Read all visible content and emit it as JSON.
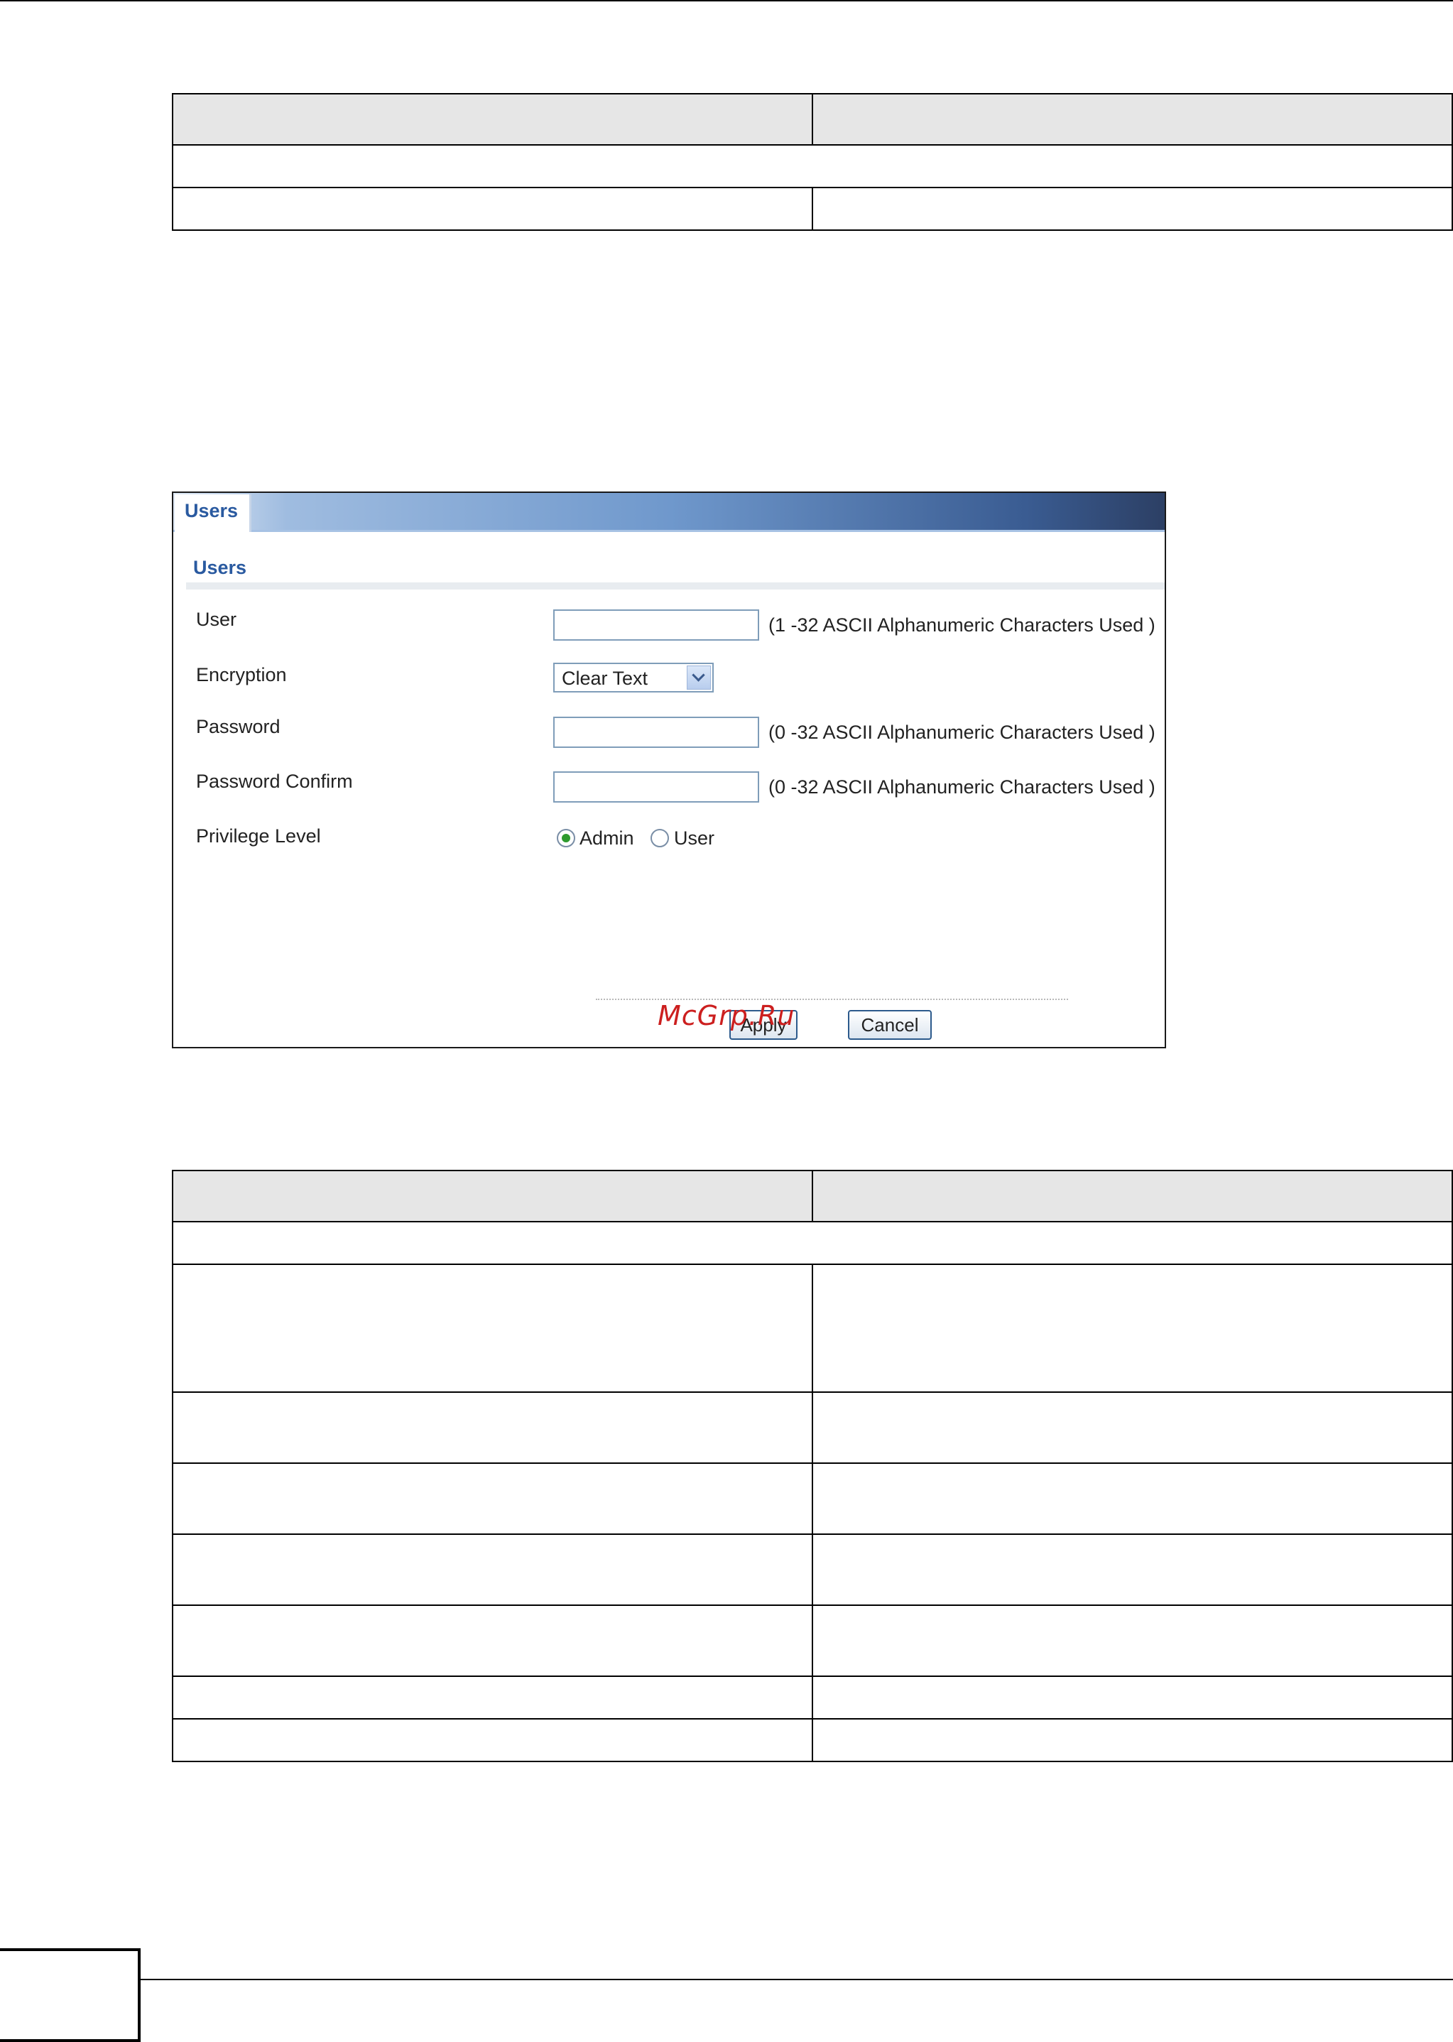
{
  "users_panel": {
    "tab_label": "Users",
    "section_title": "Users",
    "fields": {
      "user_label": "User",
      "user_value": "",
      "user_hint": "(1 -32 ASCII Alphanumeric Characters Used )",
      "encryption_label": "Encryption",
      "encryption_selected": "Clear Text",
      "password_label": "Password",
      "password_value": "",
      "password_hint": "(0 -32 ASCII Alphanumeric Characters Used )",
      "password_confirm_label": "Password Confirm",
      "password_confirm_value": "",
      "password_confirm_hint": "(0 -32 ASCII Alphanumeric Characters Used )",
      "privilege_label": "Privilege Level",
      "privilege_options": [
        "Admin",
        "User"
      ],
      "privilege_selected": "Admin"
    },
    "buttons": {
      "apply": "Apply",
      "cancel": "Cancel"
    },
    "watermark": "McGrp.Ru"
  },
  "colors": {
    "panel_title_blue": "#2a5aa0",
    "titlebar_dark": "#2c3f64",
    "radio_selected": "#2e9a2e",
    "watermark_red": "#cc1f1f",
    "table_header_gray": "#e6e6e6"
  },
  "icons": [
    "chevron-down-icon",
    "radio-selected-icon",
    "radio-unselected-icon"
  ]
}
